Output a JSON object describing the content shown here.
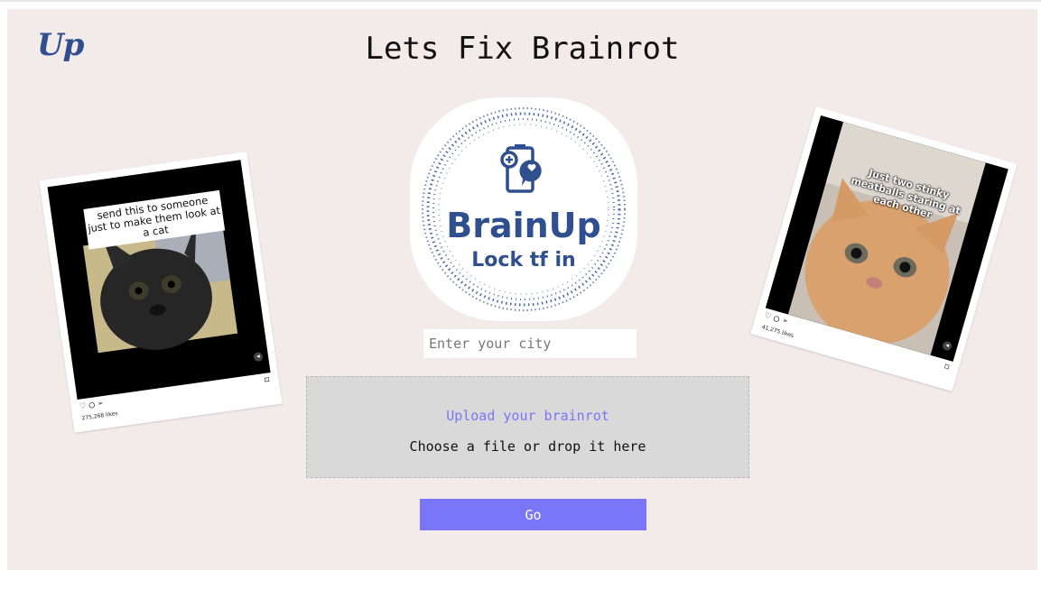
{
  "header": {
    "logo_text": "Up",
    "title": "Lets Fix Brainrot"
  },
  "badge": {
    "name": "BrainUp",
    "tagline": "Lock tf in",
    "icon": "phone-brain-health-icon",
    "accent_color": "#2f4f8f"
  },
  "city_input": {
    "value": "",
    "placeholder": "Enter your city"
  },
  "upload": {
    "title": "Upload your brainrot",
    "hint": "Choose a file or drop it here",
    "title_color": "#7b76f7"
  },
  "go_button": {
    "label": "Go",
    "color": "#7b76f7"
  },
  "posts": [
    {
      "caption": "send this to someone just to make them look at a cat",
      "likes": "275,268 likes"
    },
    {
      "caption": "Just two stinky meatballs staring at each other",
      "likes": "41,275 likes"
    }
  ]
}
